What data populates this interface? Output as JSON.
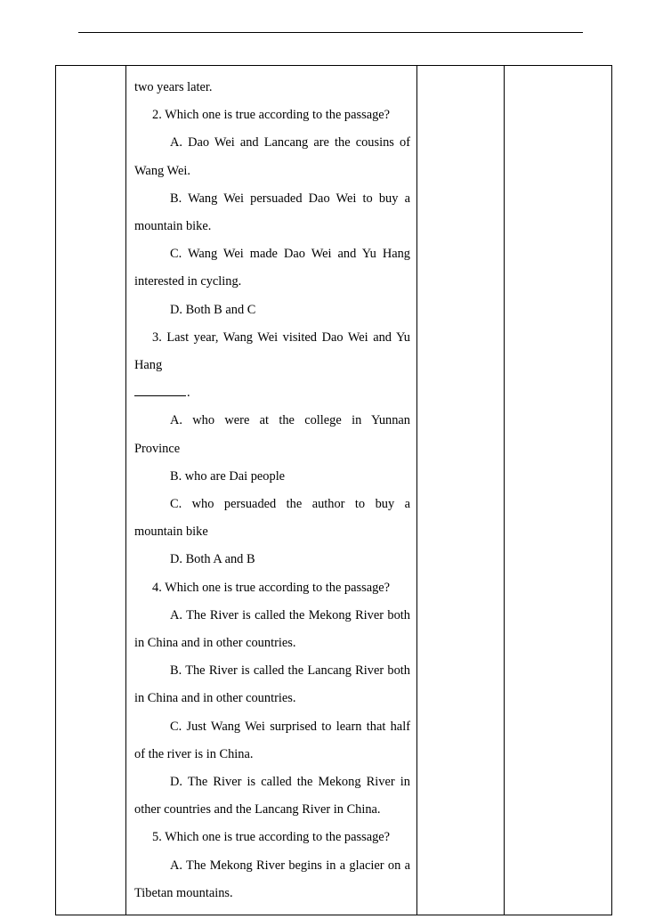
{
  "document": {
    "header_rule": "horizontal-rule",
    "table": {
      "columns": [
        "label",
        "content",
        "notes-b",
        "notes-c"
      ],
      "label_cell": "",
      "notes_b_cell": "",
      "notes_c_cell": ""
    },
    "content": {
      "lines": [
        {
          "id": "l01",
          "indent": "flush",
          "text": "two years later."
        },
        {
          "id": "l02",
          "indent": "indent1",
          "text": "2. Which one is true according to the passage?"
        },
        {
          "id": "l03",
          "indent": "indent2",
          "text": "A. Dao Wei and Lancang are the cousins of Wang Wei."
        },
        {
          "id": "l04",
          "indent": "indent2",
          "text": "B. Wang Wei persuaded Dao Wei to buy a mountain bike."
        },
        {
          "id": "l05",
          "indent": "indent2",
          "text": "C. Wang Wei made Dao Wei and Yu Hang interested in cycling."
        },
        {
          "id": "l06",
          "indent": "indent2",
          "text": "D. Both B and C"
        },
        {
          "id": "l07",
          "indent": "indent1",
          "text": "3. Last year, Wang Wei visited Dao Wei and Yu Hang"
        },
        {
          "id": "l08",
          "indent": "flush",
          "text": ".",
          "has_blank": true
        },
        {
          "id": "l09",
          "indent": "indent2",
          "text": "A. who were at the college in Yunnan Province"
        },
        {
          "id": "l10",
          "indent": "indent2",
          "text": "B. who are Dai people"
        },
        {
          "id": "l11",
          "indent": "indent2",
          "text": "C. who persuaded the author to buy a mountain bike"
        },
        {
          "id": "l12",
          "indent": "indent2",
          "text": "D. Both A and B"
        },
        {
          "id": "l13",
          "indent": "indent1",
          "text": "4. Which one is true according to the passage?"
        },
        {
          "id": "l14",
          "indent": "indent2",
          "text": "A. The River is called the Mekong River both in China and in other countries."
        },
        {
          "id": "l15",
          "indent": "indent2",
          "text": "B. The River is called the Lancang River both in China and in other countries."
        },
        {
          "id": "l16",
          "indent": "indent2",
          "text": "C. Just Wang Wei surprised to learn that half of the river is in China."
        },
        {
          "id": "l17",
          "indent": "indent2",
          "text": "D. The River is called the Mekong River in other countries and the Lancang River in China."
        },
        {
          "id": "l18",
          "indent": "indent1",
          "text": "5. Which one is true according to the passage?"
        },
        {
          "id": "l19",
          "indent": "indent2",
          "text": "A. The Mekong River begins in a glacier on a Tibetan mountains."
        }
      ]
    }
  },
  "colors": {
    "text": "#000000",
    "border": "#000000",
    "background": "#ffffff"
  }
}
